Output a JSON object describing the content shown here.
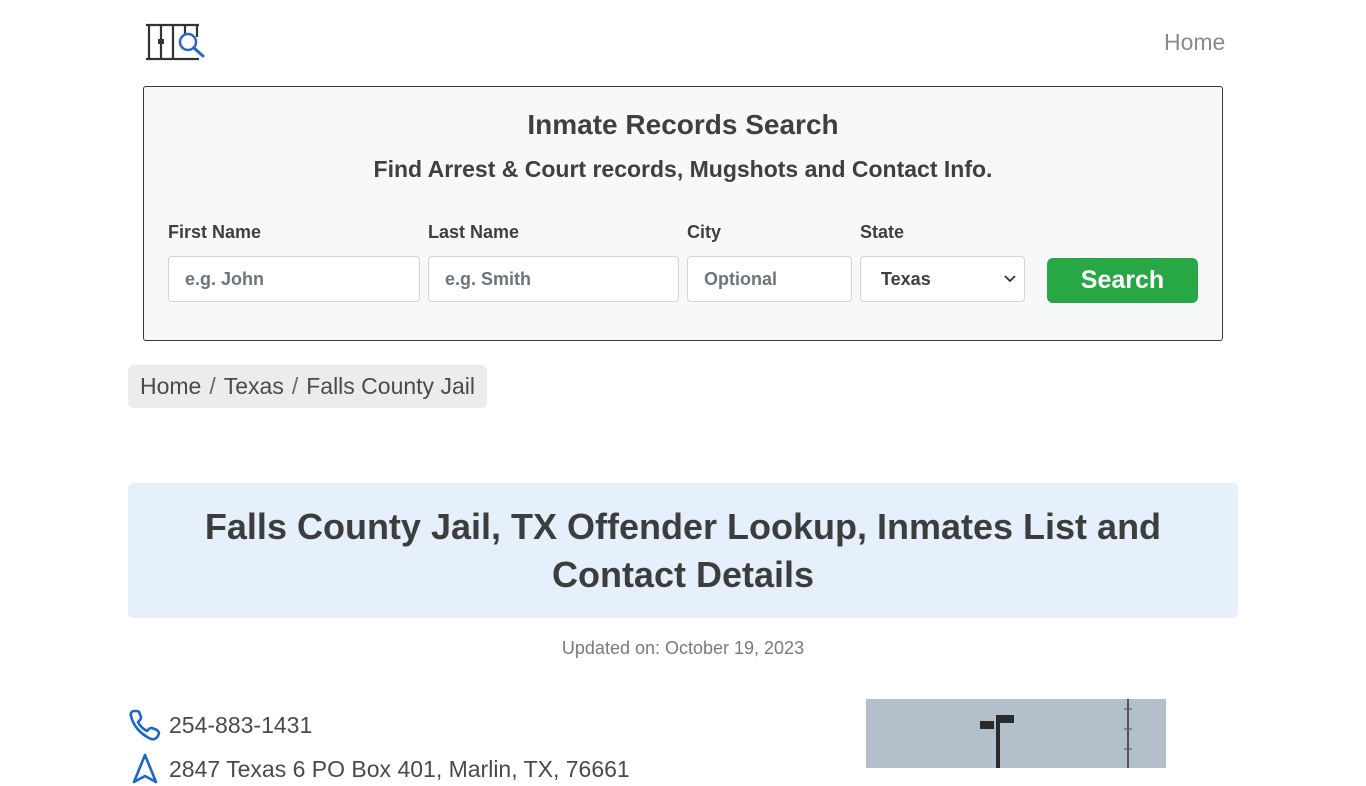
{
  "nav": {
    "home_label": "Home"
  },
  "search": {
    "title": "Inmate Records Search",
    "subtitle": "Find Arrest & Court records, Mugshots and Contact Info.",
    "first_name_label": "First Name",
    "first_name_placeholder": "e.g. John",
    "last_name_label": "Last Name",
    "last_name_placeholder": "e.g. Smith",
    "city_label": "City",
    "city_placeholder": "Optional",
    "state_label": "State",
    "state_value": "Texas",
    "button_label": "Search",
    "button_color": "#28a745"
  },
  "breadcrumb": {
    "items": [
      "Home",
      "Texas",
      "Falls County Jail"
    ],
    "separator": "/"
  },
  "page": {
    "title": "Falls County Jail, TX Offender Lookup, Inmates List and Contact Details",
    "updated": "Updated on: October 19, 2023"
  },
  "contact": {
    "phone": "254-883-1431",
    "address": "2847 Texas 6 PO Box 401, Marlin, TX, 76661",
    "phone_icon": "phone-icon",
    "address_icon": "map-marker-icon",
    "icon_color": "#1a66c9"
  },
  "colors": {
    "hero_bg": "#e6effc",
    "accent_blue": "#1a66c9"
  }
}
